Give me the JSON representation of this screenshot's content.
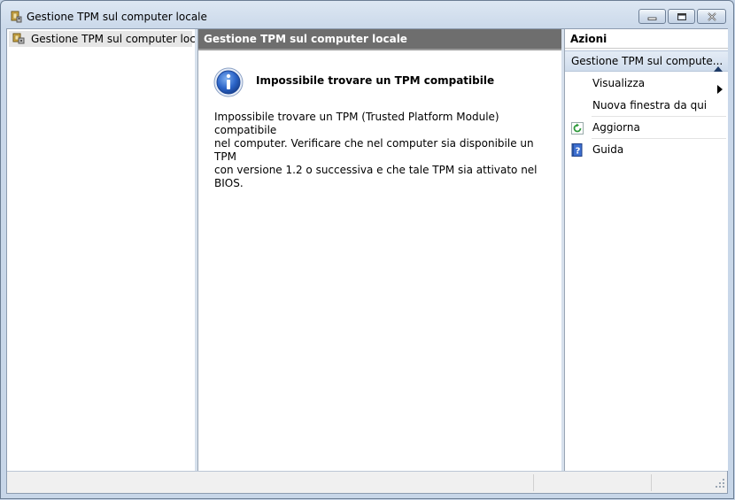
{
  "window": {
    "title": "Gestione TPM sul computer locale",
    "icon": "tpm-chip-icon"
  },
  "tree": {
    "items": [
      {
        "label": "Gestione TPM sul computer locale",
        "icon": "tpm-chip-icon",
        "selected": true
      }
    ]
  },
  "center": {
    "header": "Gestione TPM sul computer locale",
    "info_title": "Impossibile trovare un TPM compatibile",
    "info_lines": [
      "Impossibile trovare un TPM (Trusted Platform Module) compatibile",
      "nel computer. Verificare che nel computer sia disponibile un TPM",
      "con versione 1.2 o successiva e che tale TPM sia attivato nel BIOS."
    ],
    "icon": "info-icon"
  },
  "actions": {
    "header": "Azioni",
    "group_label": "Gestione TPM sul compute...",
    "items": [
      {
        "label": "Visualizza",
        "icon": "",
        "submenu": true
      },
      {
        "label": "Nuova finestra da qui",
        "icon": "",
        "submenu": false
      },
      {
        "label": "Aggiorna",
        "icon": "refresh-icon",
        "submenu": false
      },
      {
        "label": "Guida",
        "icon": "help-icon",
        "submenu": false
      }
    ]
  },
  "colors": {
    "header_bg": "#6e6e6e",
    "selection_bg": "#e6e6e6",
    "frame": "#c7d6e8"
  }
}
